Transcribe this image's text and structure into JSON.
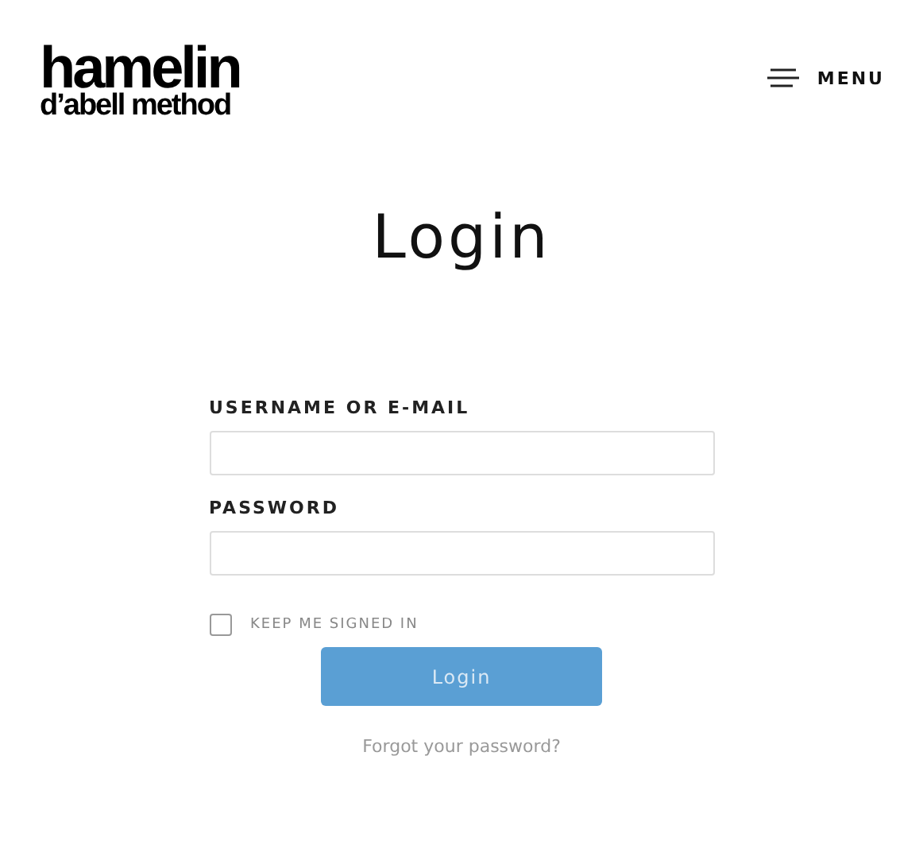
{
  "header": {
    "logo": {
      "line_1": "hamelin",
      "line_2": "d’abell method"
    },
    "menu": {
      "label": "MENU"
    }
  },
  "title": "Login",
  "fields": [
    {
      "label": "USERNAME OR E-MAIL"
    },
    {
      "label": "PASSWORD"
    }
  ],
  "remember": {
    "label": "KEEP ME SIGNED IN",
    "checked": false
  },
  "submit": "Login",
  "forgot_link": "Forgot your password?"
}
